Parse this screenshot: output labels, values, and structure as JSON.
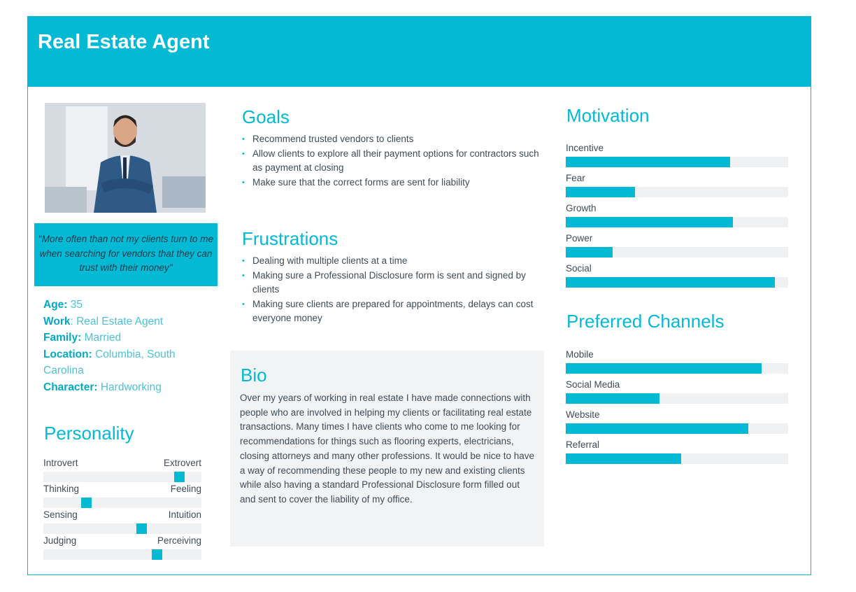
{
  "title": "Real Estate Agent",
  "quote": "\"More often than not my clients turn to me when searching for vendors that they can trust with their money\"",
  "facts": [
    {
      "label": "Age:",
      "value": "35"
    },
    {
      "label": "Work",
      "value": ": Real Estate Agent"
    },
    {
      "label": "Family:",
      "value": "Married"
    },
    {
      "label": "Location:",
      "value": "Columbia, South Carolina"
    },
    {
      "label": "Character:",
      "value": "Hardworking"
    }
  ],
  "personality": {
    "heading": "Personality",
    "traits": [
      {
        "left": "Introvert",
        "right": "Extrovert",
        "value": 0.86
      },
      {
        "left": "Thinking",
        "right": "Feeling",
        "value": 0.27
      },
      {
        "left": "Sensing",
        "right": "Intuition",
        "value": 0.62
      },
      {
        "left": "Judging",
        "right": "Perceiving",
        "value": 0.72
      }
    ]
  },
  "goals": {
    "heading": "Goals",
    "items": [
      "Recommend trusted vendors to clients",
      "Allow clients to explore all their payment options for contractors such as payment at closing",
      "Make sure that the correct forms are sent for liability"
    ]
  },
  "frustrations": {
    "heading": "Frustrations",
    "items": [
      "Dealing with multiple clients at a time",
      "Making sure a Professional Disclosure form is sent and signed by clients",
      "Making sure clients are prepared for appointments, delays can cost everyone money"
    ]
  },
  "bio": {
    "heading": "Bio",
    "text": "Over my years of working in real estate I have made connections with people who are involved in helping my clients or facilitating real estate transactions.  Many times I have clients who come to me looking for recommendations for things such as flooring experts, electricians, closing attorneys and many other professions.  It would be nice to have a way of recommending these people to my new and existing clients while also having a standard Professional Disclosure form filled out and sent to cover the liability of my office."
  },
  "motivation": {
    "heading": "Motivation",
    "items": [
      {
        "label": "Incentive",
        "value": 0.74
      },
      {
        "label": "Fear",
        "value": 0.31
      },
      {
        "label": "Growth",
        "value": 0.75
      },
      {
        "label": "Power",
        "value": 0.21
      },
      {
        "label": "Social",
        "value": 0.94
      }
    ]
  },
  "channels": {
    "heading": "Preferred Channels",
    "items": [
      {
        "label": "Mobile",
        "value": 0.88
      },
      {
        "label": "Social Media",
        "value": 0.42
      },
      {
        "label": "Website",
        "value": 0.82
      },
      {
        "label": "Referral",
        "value": 0.52
      }
    ]
  },
  "colors": {
    "accent": "#03b9d4",
    "track": "#f0f1f3",
    "text": "#3f4b56"
  }
}
